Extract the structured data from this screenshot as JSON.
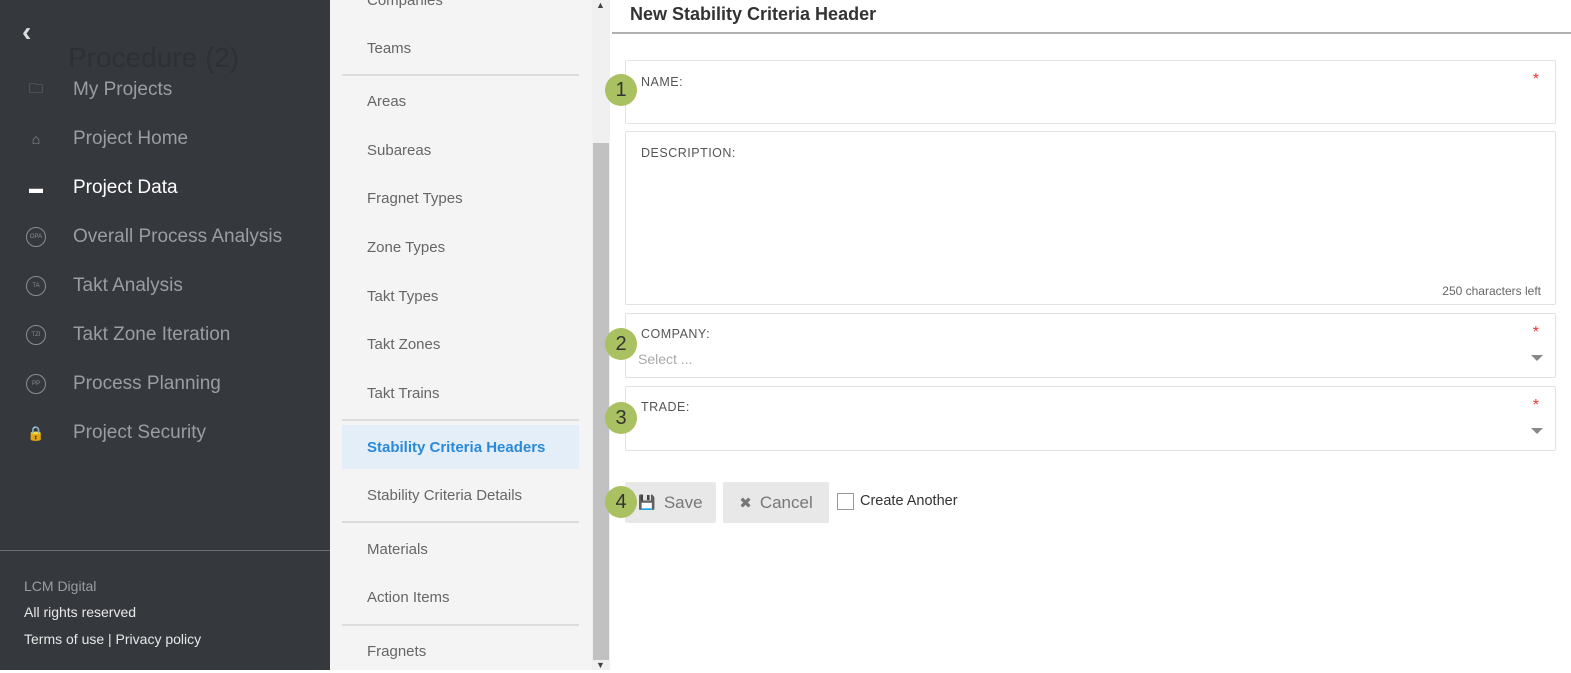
{
  "sidebar": {
    "ghost_title": "Procedure (2)",
    "items": [
      {
        "label": "My Projects",
        "icon": "folder-icon"
      },
      {
        "label": "Project Home",
        "icon": "home-icon"
      },
      {
        "label": "Project Data",
        "icon": "folder-open-icon",
        "active": true
      },
      {
        "label": "Overall Process Analysis",
        "icon": "opa-icon",
        "abbr": "OPA"
      },
      {
        "label": "Takt Analysis",
        "icon": "ta-icon",
        "abbr": "TA"
      },
      {
        "label": "Takt Zone Iteration",
        "icon": "tzi-icon",
        "abbr": "TZI"
      },
      {
        "label": "Process Planning",
        "icon": "pp-icon",
        "abbr": "PP"
      },
      {
        "label": "Project Security",
        "icon": "lock-icon"
      }
    ],
    "footer": {
      "company": "LCM Digital",
      "rights": "All rights reserved",
      "links": "Terms of use | Privacy policy"
    }
  },
  "menu": {
    "items": [
      "Companies",
      "Teams",
      "Areas",
      "Subareas",
      "Fragnet Types",
      "Zone Types",
      "Takt Types",
      "Takt Zones",
      "Takt Trains",
      "Stability Criteria Headers",
      "Stability Criteria Details",
      "Materials",
      "Action Items",
      "Fragnets"
    ],
    "active": "Stability Criteria Headers"
  },
  "form": {
    "title": "New Stability Criteria Header",
    "name_label": "NAME:",
    "description_label": "DESCRIPTION:",
    "chars_left": "250 characters left",
    "company_label": "COMPANY:",
    "company_placeholder": "Select ...",
    "trade_label": "TRADE:",
    "required_mark": "*",
    "save": "Save",
    "cancel": "Cancel",
    "create_another": "Create Another"
  },
  "badges": [
    "1",
    "2",
    "3",
    "4"
  ],
  "colors": {
    "sidebar": "#35383d",
    "accent": "#2a8ad8",
    "badge": "#a9c160",
    "required": "#e53935"
  }
}
